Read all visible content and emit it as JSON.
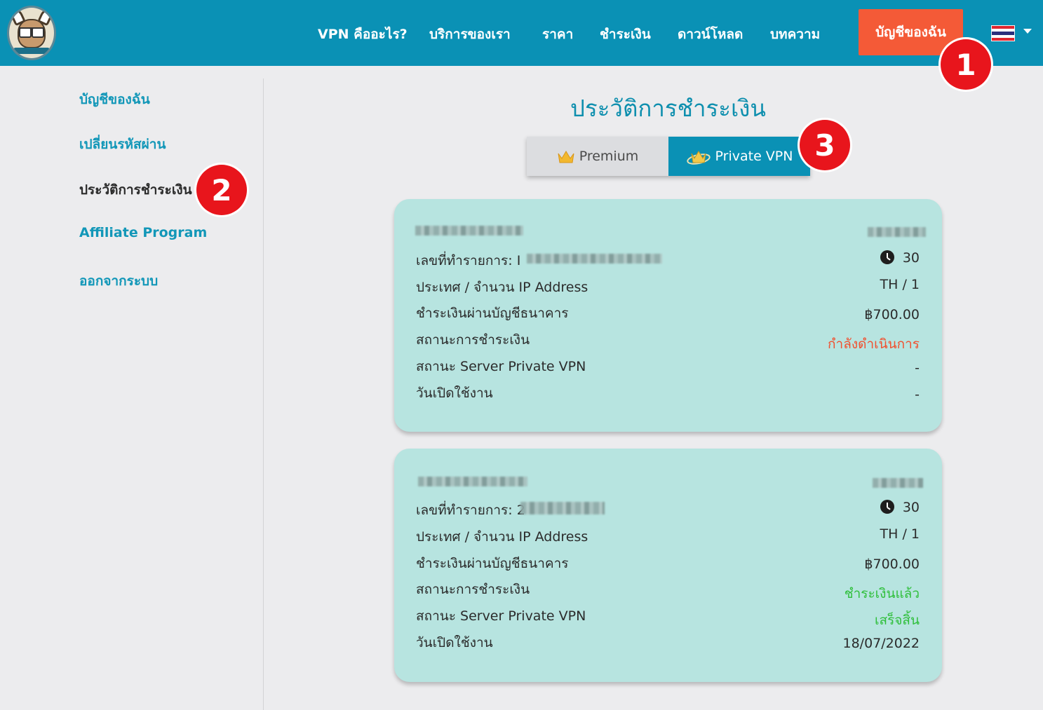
{
  "header": {
    "nav": [
      {
        "id": "what-is-vpn",
        "label": "VPN คืออะไร?"
      },
      {
        "id": "services",
        "label": "บริการของเรา"
      },
      {
        "id": "pricing",
        "label": "ราคา"
      },
      {
        "id": "payment",
        "label": "ชำระเงิน"
      },
      {
        "id": "download",
        "label": "ดาวน์โหลด"
      },
      {
        "id": "articles",
        "label": "บทความ"
      }
    ],
    "account_button": "บัญชีของฉัน",
    "language_flag_icon": "thailand-flag-icon"
  },
  "sidebar": {
    "items": [
      {
        "label": "บัญชีของฉัน",
        "active": false
      },
      {
        "label": "เปลี่ยนรหัสผ่าน",
        "active": false
      },
      {
        "label": "ประวัติการชำระเงิน",
        "active": true
      },
      {
        "label": "Affiliate Program",
        "active": false
      },
      {
        "label": "ออกจากระบบ",
        "active": false
      }
    ]
  },
  "main": {
    "title": "ประวัติการชำระเงิน",
    "tabs": [
      {
        "label": "Premium",
        "icon": "crown-icon",
        "selected": false
      },
      {
        "label": "Private VPN",
        "icon": "crown-icon",
        "selected": true
      }
    ],
    "cards": [
      {
        "transaction_label": "เลขที่ทำรายการ:",
        "transaction_prefix": "I",
        "days": "30",
        "rows": [
          {
            "label": "ประเทศ / จำนวน IP Address",
            "value": "TH / 1",
            "status": "normal"
          },
          {
            "label": "ชำระเงินผ่านบัญชีธนาคาร",
            "value": "฿700.00",
            "status": "normal"
          },
          {
            "label": "สถานะการชำระเงิน",
            "value": "กำลังดำเนินการ",
            "status": "pending"
          },
          {
            "label": "สถานะ Server Private VPN",
            "value": "-",
            "status": "normal"
          },
          {
            "label": "วันเปิดใช้งาน",
            "value": "-",
            "status": "normal"
          }
        ]
      },
      {
        "transaction_label": "เลขที่ทำรายการ:",
        "transaction_prefix": "2",
        "days": "30",
        "rows": [
          {
            "label": "ประเทศ / จำนวน IP Address",
            "value": "TH / 1",
            "status": "normal"
          },
          {
            "label": "ชำระเงินผ่านบัญชีธนาคาร",
            "value": "฿700.00",
            "status": "normal"
          },
          {
            "label": "สถานะการชำระเงิน",
            "value": "ชำระเงินแล้ว",
            "status": "success"
          },
          {
            "label": "สถานะ Server Private VPN",
            "value": "เสร็จสิ้น",
            "status": "success"
          },
          {
            "label": "วันเปิดใช้งาน",
            "value": "18/07/2022",
            "status": "normal"
          }
        ]
      }
    ]
  },
  "annotations": [
    {
      "number": "1"
    },
    {
      "number": "2"
    },
    {
      "number": "3"
    }
  ],
  "colors": {
    "header_bg": "#0a91b5",
    "account_button": "#f45a37",
    "card_bg": "#b7e4e0",
    "pending": "#f1502f",
    "success": "#2fbf3b",
    "marker": "#e8151c"
  }
}
